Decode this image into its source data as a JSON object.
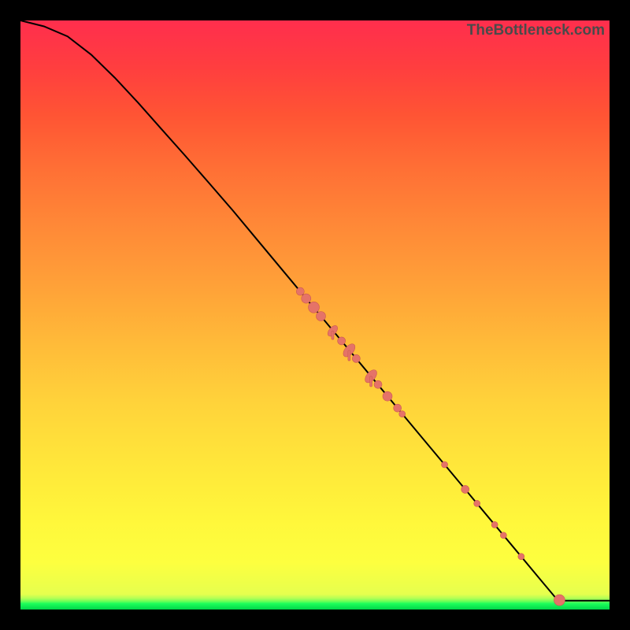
{
  "watermark": "TheBottleneck.com",
  "colors": {
    "point_fill": "#e57368",
    "point_stroke": "#cc5a50",
    "curve": "#000000"
  },
  "chart_data": {
    "type": "line",
    "title": "",
    "xlabel": "",
    "ylabel": "",
    "xlim": [
      0,
      100
    ],
    "ylim": [
      0,
      100
    ],
    "curve": [
      {
        "x": 0,
        "y": 100
      },
      {
        "x": 4,
        "y": 99
      },
      {
        "x": 8,
        "y": 97.3
      },
      {
        "x": 12,
        "y": 94.2
      },
      {
        "x": 16,
        "y": 90.3
      },
      {
        "x": 20,
        "y": 86
      },
      {
        "x": 24,
        "y": 81.5
      },
      {
        "x": 28,
        "y": 77
      },
      {
        "x": 32,
        "y": 72.4
      },
      {
        "x": 36,
        "y": 67.8
      },
      {
        "x": 40,
        "y": 63
      },
      {
        "x": 44,
        "y": 58.2
      },
      {
        "x": 48,
        "y": 53.4
      },
      {
        "x": 52,
        "y": 48.6
      },
      {
        "x": 56,
        "y": 43.8
      },
      {
        "x": 60,
        "y": 39
      },
      {
        "x": 64,
        "y": 34.2
      },
      {
        "x": 68,
        "y": 29.4
      },
      {
        "x": 72,
        "y": 24.6
      },
      {
        "x": 76,
        "y": 19.8
      },
      {
        "x": 80,
        "y": 15
      },
      {
        "x": 84,
        "y": 10.2
      },
      {
        "x": 88,
        "y": 5.4
      },
      {
        "x": 91,
        "y": 1.8
      },
      {
        "x": 92.5,
        "y": 1.5
      },
      {
        "x": 100,
        "y": 1.5
      }
    ],
    "points": [
      {
        "x": 47.5,
        "y": 54,
        "r": 5
      },
      {
        "x": 48.5,
        "y": 52.8,
        "r": 6
      },
      {
        "x": 49.8,
        "y": 51.3,
        "r": 7
      },
      {
        "x": 51.0,
        "y": 49.8,
        "r": 6
      },
      {
        "x": 53.0,
        "y": 47.3,
        "r": 5,
        "stretch": 3
      },
      {
        "x": 54.5,
        "y": 45.6,
        "r": 5
      },
      {
        "x": 55.8,
        "y": 44.0,
        "r": 6,
        "stretch": 3
      },
      {
        "x": 57.0,
        "y": 42.6,
        "r": 5
      },
      {
        "x": 59.5,
        "y": 39.6,
        "r": 6,
        "stretch": 3
      },
      {
        "x": 60.7,
        "y": 38.2,
        "r": 5
      },
      {
        "x": 62.3,
        "y": 36.2,
        "r": 6
      },
      {
        "x": 64.0,
        "y": 34.2,
        "r": 5
      },
      {
        "x": 64.8,
        "y": 33.2,
        "r": 4
      },
      {
        "x": 72.0,
        "y": 24.6,
        "r": 4
      },
      {
        "x": 75.5,
        "y": 20.4,
        "r": 5
      },
      {
        "x": 77.5,
        "y": 18.0,
        "r": 4
      },
      {
        "x": 80.5,
        "y": 14.4,
        "r": 4
      },
      {
        "x": 82.0,
        "y": 12.6,
        "r": 4
      },
      {
        "x": 85.0,
        "y": 9.0,
        "r": 4
      },
      {
        "x": 91.5,
        "y": 1.6,
        "r": 7
      }
    ]
  }
}
